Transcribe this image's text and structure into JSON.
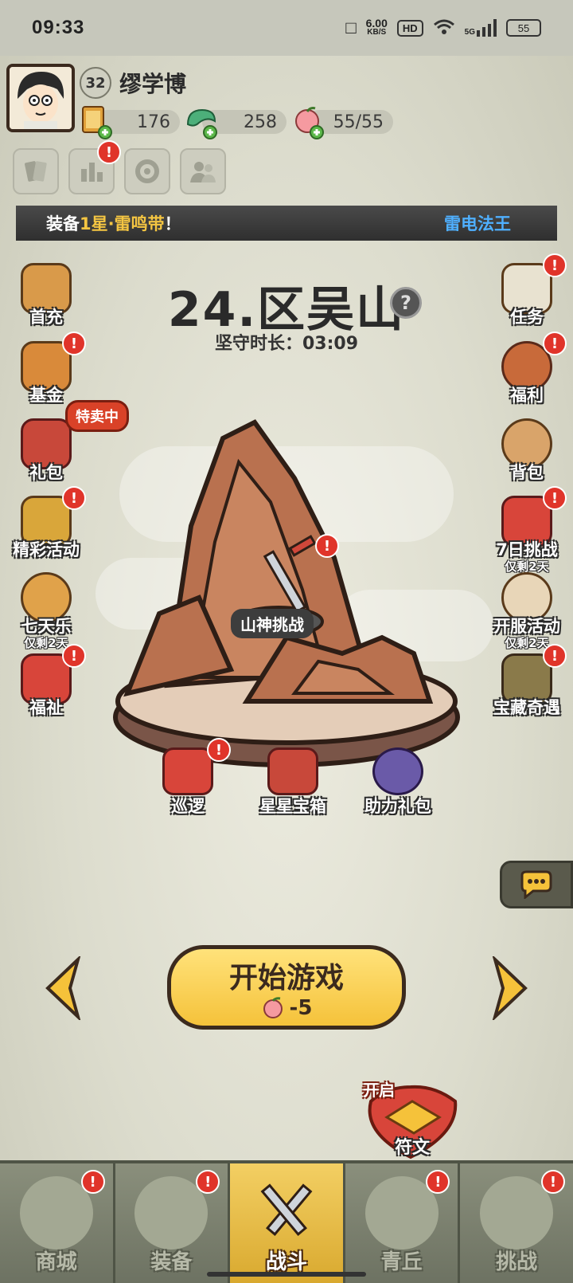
{
  "status_bar": {
    "time": "09:33",
    "net_speed": "6.00",
    "net_unit": "KB/S",
    "hd": "HD",
    "network": "5G",
    "battery": "55"
  },
  "player": {
    "name": "缪学博",
    "level": "32",
    "resources": [
      {
        "name": "ticket",
        "value": "176"
      },
      {
        "name": "jade",
        "value": "258"
      },
      {
        "name": "peach",
        "value": "55/55"
      }
    ]
  },
  "marquee": {
    "text_a": "装备",
    "highlight": "1星·雷鸣带",
    "text_b": "！",
    "highlight_2": "雷电法王"
  },
  "stage": {
    "title": "24.区吴山",
    "help": "?",
    "timer": "坚守时长：03:09",
    "challenge": "山神挑战"
  },
  "left_items": [
    {
      "label": "首充",
      "sub": "",
      "badge": ""
    },
    {
      "label": "基金",
      "sub": "",
      "badge": "!"
    },
    {
      "label": "礼包",
      "sub": "",
      "badge": ""
    },
    {
      "label": "精彩活动",
      "sub": "",
      "badge": "!"
    },
    {
      "label": "七天乐",
      "sub": "仅剩2天",
      "badge": ""
    },
    {
      "label": "福祉",
      "sub": "",
      "badge": "!"
    }
  ],
  "sale_tag": "特卖中",
  "right_items": [
    {
      "label": "任务",
      "sub": "",
      "badge": "!"
    },
    {
      "label": "福利",
      "sub": "",
      "badge": "!"
    },
    {
      "label": "背包",
      "sub": "",
      "badge": ""
    },
    {
      "label": "7日挑战",
      "sub": "仅剩2天",
      "badge": "!"
    },
    {
      "label": "开服活动",
      "sub": "仅剩2天",
      "badge": ""
    },
    {
      "label": "宝藏奇遇",
      "sub": "",
      "badge": "!"
    }
  ],
  "bottom_items": [
    {
      "label": "巡逻",
      "badge": "!"
    },
    {
      "label": "星星宝箱",
      "badge": ""
    },
    {
      "label": "助力礼包",
      "badge": ""
    }
  ],
  "start": {
    "label": "开始游戏",
    "cost": "-5"
  },
  "rune": {
    "open": "开启",
    "label": "符文"
  },
  "nav": [
    {
      "label": "商城",
      "badge": "!",
      "active": false
    },
    {
      "label": "装备",
      "badge": "!",
      "active": false
    },
    {
      "label": "战斗",
      "badge": "",
      "active": true
    },
    {
      "label": "青丘",
      "badge": "!",
      "active": false
    },
    {
      "label": "挑战",
      "badge": "!",
      "active": false
    }
  ],
  "colors": {
    "accent_gold": "#f5c23a",
    "badge_red": "#e0342a",
    "marquee_highlight": "#f4c542",
    "marquee_highlight_2": "#4fb0ff"
  }
}
